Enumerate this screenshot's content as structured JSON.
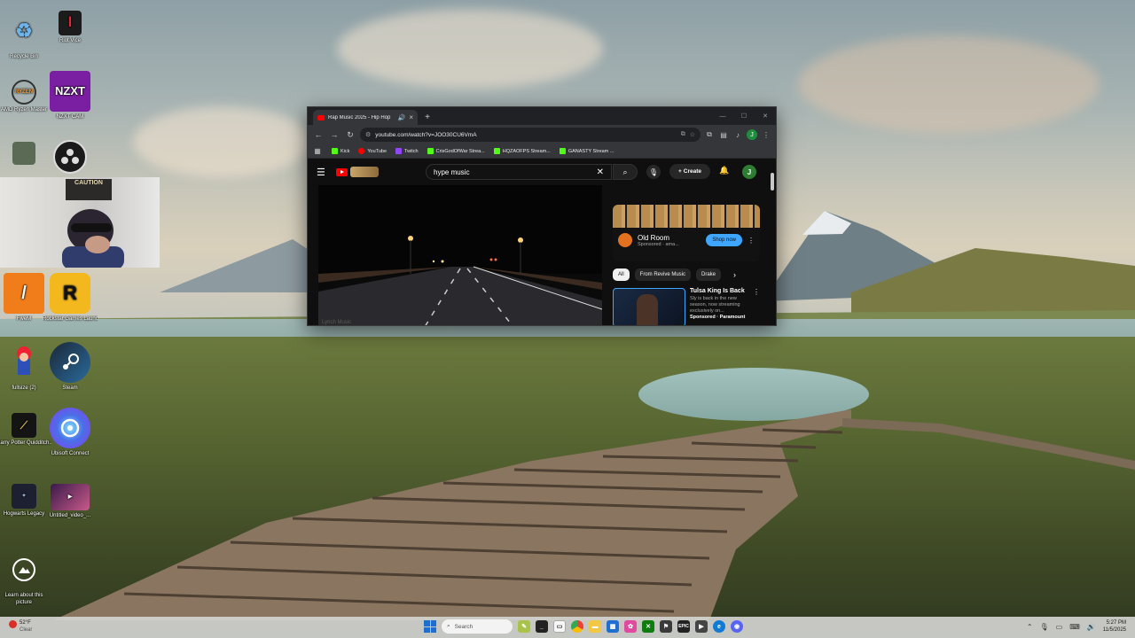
{
  "desktop": {
    "icons": [
      {
        "label": "Recycle Bin"
      },
      {
        "label": "Riot Vice"
      },
      {
        "label": "AMD Ryzen Master"
      },
      {
        "label": "NZXT CAM",
        "tile_text": "NZXT"
      },
      {
        "label": "FiveM"
      },
      {
        "label": "Rockstar Games Launcher",
        "tile_text": "R"
      },
      {
        "label": "fullsize (2)"
      },
      {
        "label": "Steam"
      },
      {
        "label": "Harry Potter Quidditch..."
      },
      {
        "label": "Ubisoft Connect"
      },
      {
        "label": "Hogwarts Legacy"
      },
      {
        "label": "Untitled_video_..."
      },
      {
        "label": "Learn about this picture"
      }
    ],
    "webcam": {
      "poster_text": "CAUTION"
    }
  },
  "browser": {
    "tab_title": "Rap Music 2025 - Hip Hop",
    "new_tab": "+",
    "url": "youtube.com/watch?v=JOO30CU6VmA",
    "bookmarks": [
      {
        "label": "Kick",
        "color": "#53fc18"
      },
      {
        "label": "YouTube",
        "color": "#ff0000"
      },
      {
        "label": "Twitch",
        "color": "#9146ff"
      },
      {
        "label": "CrisGodOfWar Strea...",
        "color": "#53fc18"
      },
      {
        "label": "HQZAOFPS Stream...",
        "color": "#53fc18"
      },
      {
        "label": "GANASTY Stream ...",
        "color": "#53fc18"
      }
    ],
    "profile_initial": "J"
  },
  "youtube": {
    "search_query": "hype music",
    "create_label": "Create",
    "avatar_initial": "J",
    "player_watermark": "Lynch Music",
    "ad": {
      "name": "Old Room",
      "sponsored": "Sponsored · ama...",
      "cta": "Shop now"
    },
    "chips": [
      "All",
      "From Revive Music",
      "Drake"
    ],
    "recommendation": {
      "title": "Tulsa King Is Back",
      "desc_line1": "Sly is back in the new",
      "desc_line2": "season, now streaming",
      "desc_line3": "exclusively on...",
      "sponsored": "Sponsored · Paramount"
    }
  },
  "taskbar": {
    "weather_temp": "52°F",
    "weather_cond": "Clear",
    "search_placeholder": "Search",
    "time": "5:27 PM",
    "date": "11/5/2025"
  },
  "colors": {
    "yt_red": "#ff0000",
    "accent_blue": "#3ea6ff",
    "windows_blue": "#1f6fd1"
  }
}
